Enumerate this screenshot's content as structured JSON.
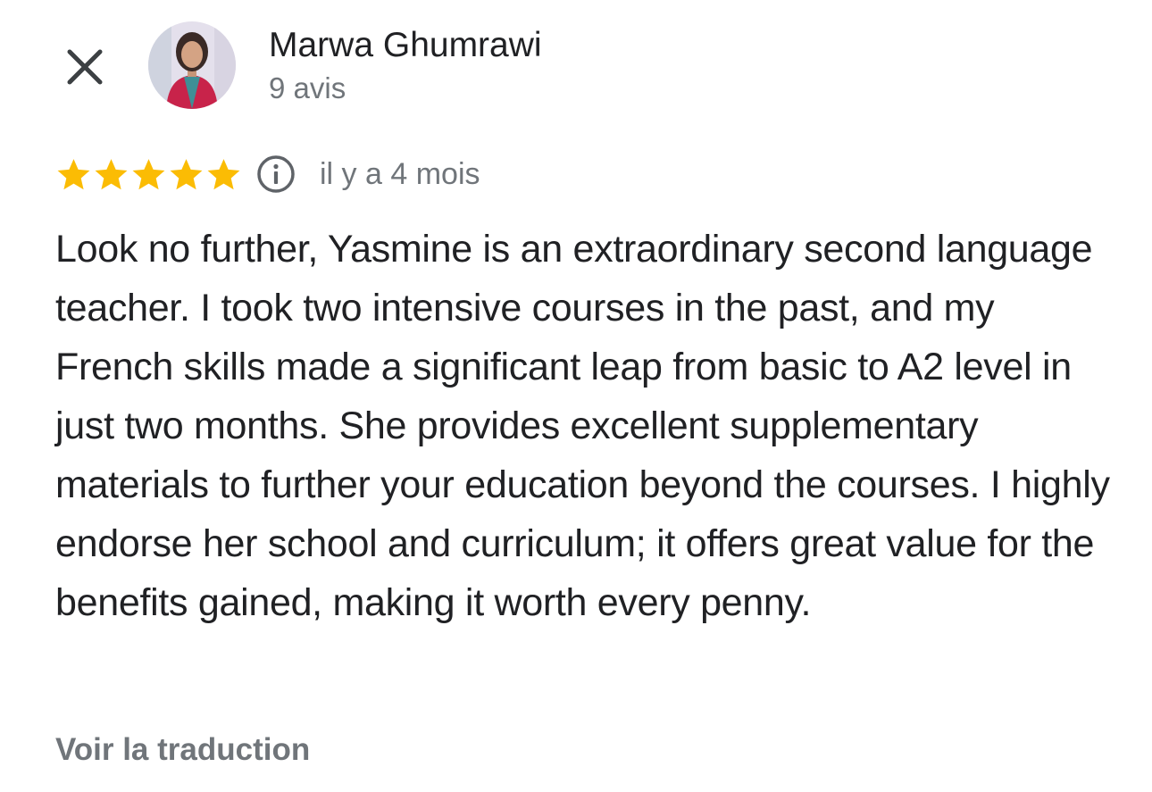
{
  "header": {
    "close_icon": "close-icon",
    "reviewer": {
      "name": "Marwa Ghumrawi",
      "review_count": "9 avis"
    }
  },
  "review": {
    "rating": 5,
    "rating_max": 5,
    "star_color": "#fbbc04",
    "info_icon": "info-icon",
    "date": "il y a 4 mois",
    "text": "Look no further, Yasmine is an extraordinary second language teacher. I took two intensive courses in the past, and my French skills made a significant leap from basic to A2 level in just two months. She provides excellent supplementary materials to further your education beyond the courses. I highly endorse her school and curriculum; it offers great value for the benefits gained, making it worth every penny.",
    "translate_label": "Voir la traduction"
  }
}
